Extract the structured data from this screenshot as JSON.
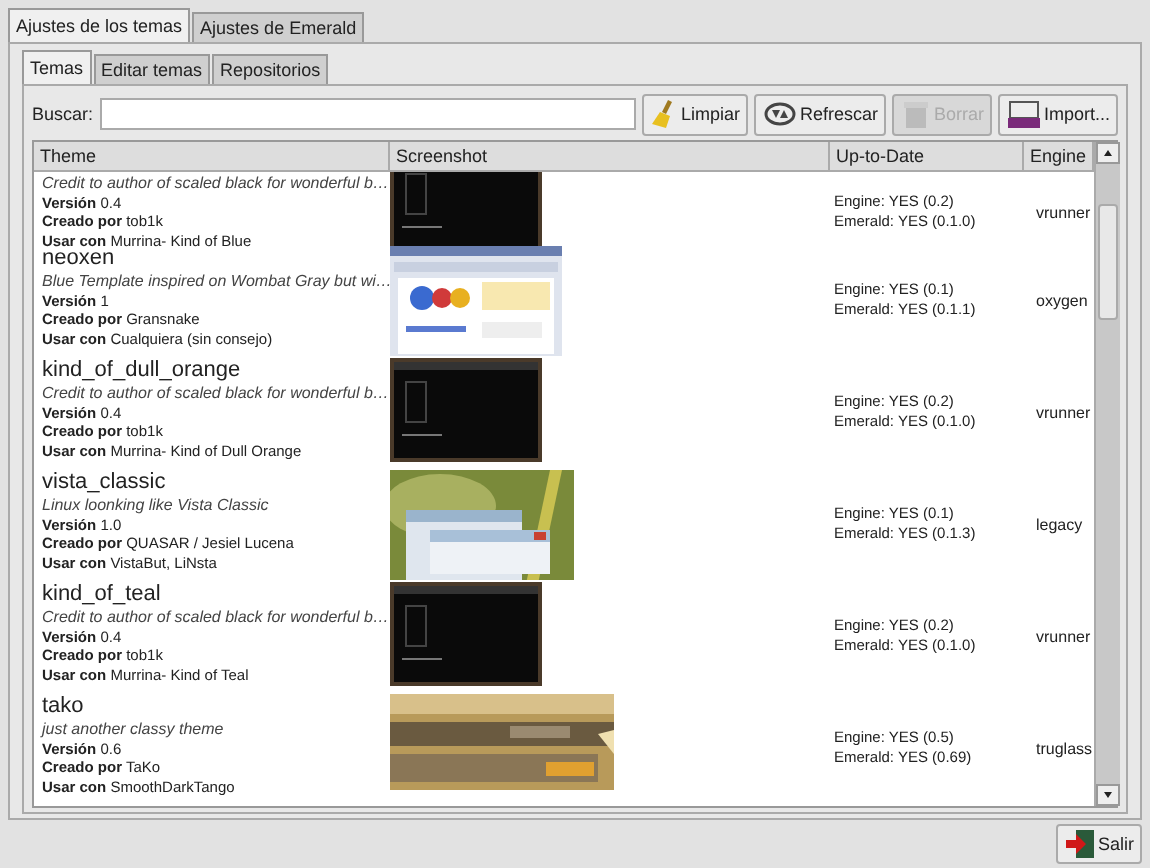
{
  "outer_tabs": [
    {
      "label": "Ajustes de los temas",
      "selected": true
    },
    {
      "label": "Ajustes de Emerald",
      "selected": false
    }
  ],
  "inner_tabs": [
    {
      "label": "Temas",
      "selected": true
    },
    {
      "label": "Editar temas",
      "selected": false
    },
    {
      "label": "Repositorios",
      "selected": false
    }
  ],
  "search": {
    "label": "Buscar:"
  },
  "toolbar": [
    {
      "label": "Limpiar",
      "disabled": false
    },
    {
      "label": "Refrescar",
      "disabled": false
    },
    {
      "label": "Borrar",
      "disabled": true
    },
    {
      "label": "Import...",
      "disabled": false
    }
  ],
  "table": {
    "columns": [
      "Theme",
      "Screenshot",
      "Up-to-Date",
      "Engine"
    ],
    "rows": [
      {
        "description": "Credit to author of scaled black for wonderful b…",
        "version_label": "Versión",
        "version": "0.4",
        "author_label": "Creado por",
        "author": "tob1k",
        "use_label": "Usar con",
        "use": "Murrina- Kind of Blue",
        "engine_status": "Engine: YES (0.2)",
        "emerald_status": "Emerald: YES (0.1.0)",
        "engine": "vrunner"
      },
      {
        "name": "neoxen",
        "description": "Blue Template inspired on Wombat Gray but wi…",
        "version_label": "Versión",
        "version": "1",
        "author_label": "Creado por",
        "author": "Gransnake",
        "use_label": "Usar con",
        "use": "Cualquiera (sin consejo)",
        "engine_status": "Engine: YES (0.1)",
        "emerald_status": "Emerald: YES (0.1.1)",
        "engine": "oxygen"
      },
      {
        "name": "kind_of_dull_orange",
        "description": "Credit to author of scaled black for wonderful b…",
        "version_label": "Versión",
        "version": "0.4",
        "author_label": "Creado por",
        "author": "tob1k",
        "use_label": "Usar con",
        "use": "Murrina- Kind of Dull Orange",
        "engine_status": "Engine: YES (0.2)",
        "emerald_status": "Emerald: YES (0.1.0)",
        "engine": "vrunner"
      },
      {
        "name": "vista_classic",
        "description": "Linux loonking like Vista Classic",
        "version_label": "Versión",
        "version": "1.0",
        "author_label": "Creado por",
        "author": "QUASAR / Jesiel Lucena",
        "use_label": "Usar con",
        "use": "VistaBut, LiNsta",
        "engine_status": "Engine: YES (0.1)",
        "emerald_status": "Emerald: YES (0.1.3)",
        "engine": "legacy"
      },
      {
        "name": "kind_of_teal",
        "description": "Credit to author of scaled black for wonderful b…",
        "version_label": "Versión",
        "version": "0.4",
        "author_label": "Creado por",
        "author": "tob1k",
        "use_label": "Usar con",
        "use": "Murrina- Kind of Teal",
        "engine_status": "Engine: YES (0.2)",
        "emerald_status": "Emerald: YES (0.1.0)",
        "engine": "vrunner"
      },
      {
        "name": "tako",
        "description": "just another classy theme",
        "version_label": "Versión",
        "version": "0.6",
        "author_label": "Creado por",
        "author": "TaKo",
        "use_label": "Usar con",
        "use": "SmoothDarkTango",
        "engine_status": "Engine: YES (0.5)",
        "emerald_status": "Emerald: YES (0.69)",
        "engine": "truglass"
      }
    ]
  },
  "footer": {
    "button": "Salir"
  }
}
